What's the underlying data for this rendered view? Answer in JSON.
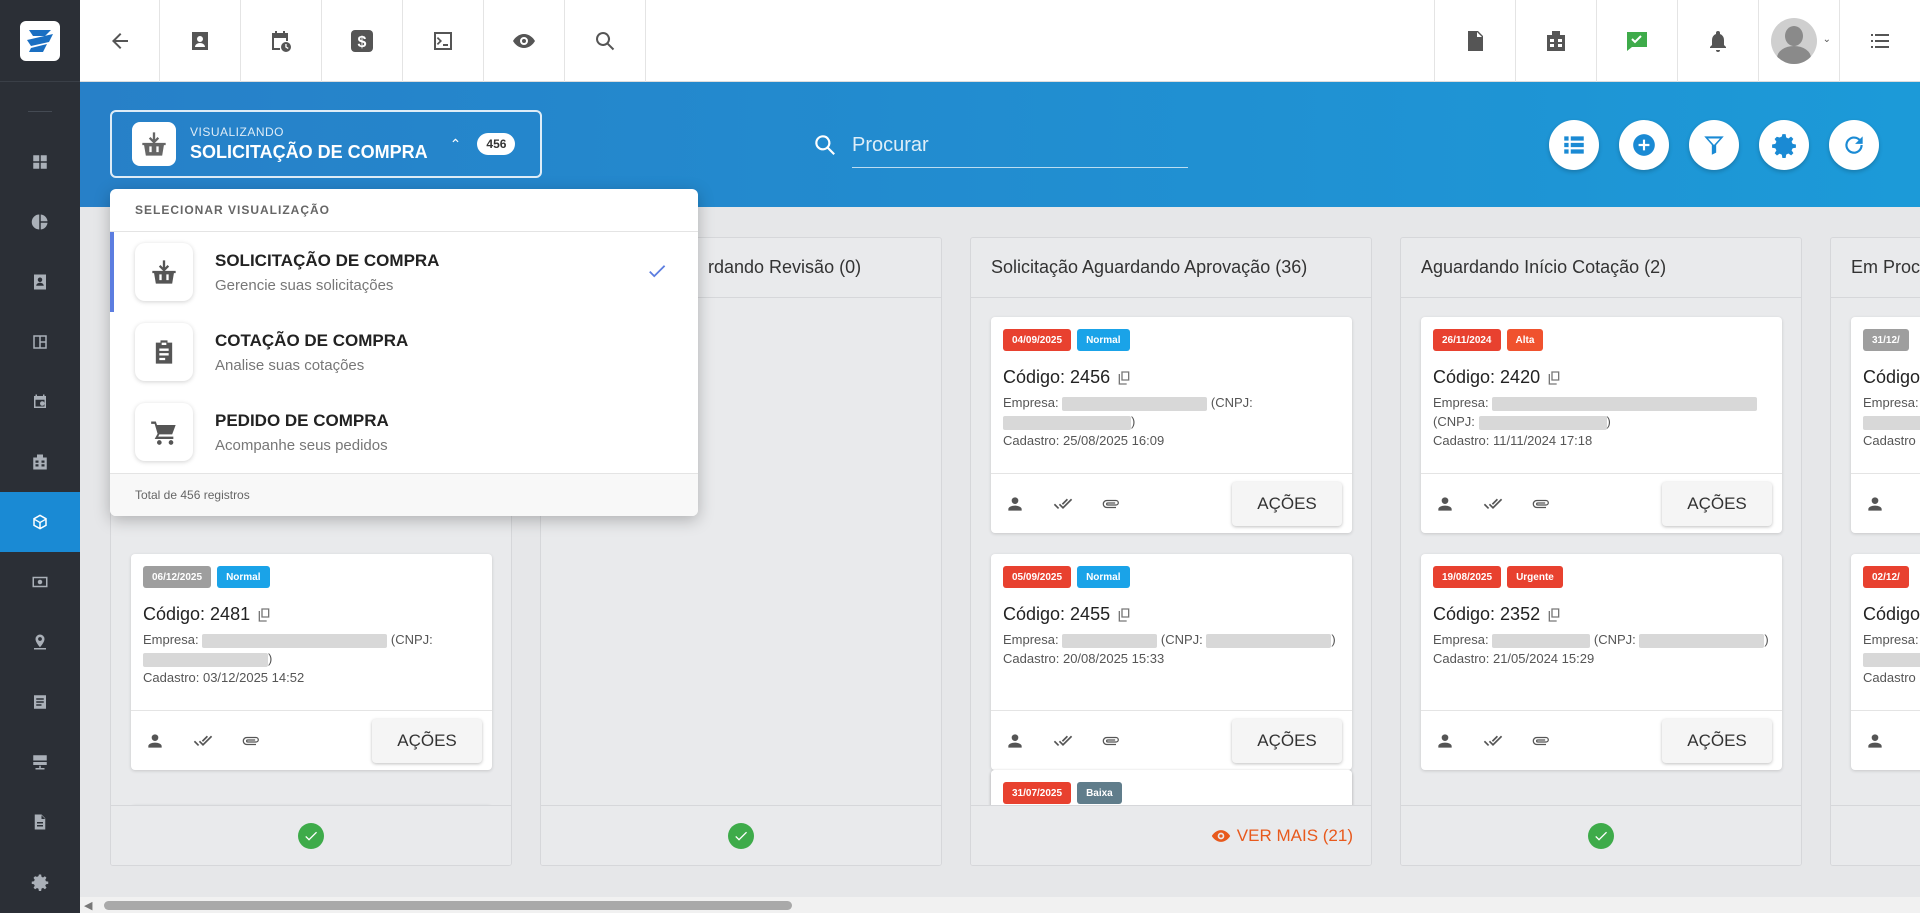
{
  "header": {
    "back_icon": "arrow-left-icon",
    "buttons": [
      "contact-card-icon",
      "calendar-clock-icon",
      "dollar-icon",
      "terminal-icon",
      "eye-icon",
      "search-icon"
    ],
    "right_buttons": [
      "pdf-icon",
      "building-icon",
      "chat-check-icon",
      "bell-icon",
      "avatar",
      "menu-list-icon"
    ]
  },
  "sidebar": {
    "items": [
      "dashboard-icon",
      "pie-chart-icon",
      "contact-icon",
      "board-icon",
      "calendar-icon",
      "building-icon",
      "package-icon",
      "money-icon",
      "map-pin-icon",
      "list-doc-icon",
      "server-icon",
      "file-icon",
      "gear-icon"
    ],
    "active": "package-icon"
  },
  "view_selector": {
    "caption": "VISUALIZANDO",
    "title": "SOLICITAÇÃO DE COMPRA",
    "count": "456"
  },
  "search": {
    "placeholder": "Procurar"
  },
  "dropdown": {
    "header": "SELECIONAR VISUALIZAÇÃO",
    "options": [
      {
        "title": "SOLICITAÇÃO DE COMPRA",
        "subtitle": "Gerencie suas solicitações",
        "selected": true
      },
      {
        "title": "COTAÇÃO DE COMPRA",
        "subtitle": "Analise suas cotações",
        "selected": false
      },
      {
        "title": "PEDIDO DE COMPRA",
        "subtitle": "Acompanhe seus pedidos",
        "selected": false
      }
    ],
    "footer": "Total de 456 registros"
  },
  "columns": [
    {
      "title": "",
      "footer": "check"
    },
    {
      "title": "rdando Revisão (0)",
      "footer": "check"
    },
    {
      "title": "Solicitação Aguardando Aprovação (36)",
      "footer": "VER MAIS (21)"
    },
    {
      "title": "Aguardando Início Cotação (2)",
      "footer": "check"
    },
    {
      "title": "Em Proc",
      "footer": ""
    }
  ],
  "cards": {
    "c1": {
      "date": "06/12/2025",
      "priority": "Normal",
      "code": "Código: 2481",
      "empresa": "Empresa:",
      "cnpj": "(CNPJ:",
      "cadastro": "Cadastro: 03/12/2025 14:52",
      "action": "AÇÕES"
    },
    "c2": {
      "date": "04/09/2025",
      "priority": "Normal",
      "code": "Código: 2456",
      "empresa": "Empresa:",
      "cnpj": "(CNPJ:",
      "cadastro": "Cadastro: 25/08/2025 16:09",
      "action": "AÇÕES"
    },
    "c3": {
      "date": "05/09/2025",
      "priority": "Normal",
      "code": "Código: 2455",
      "empresa": "Empresa:",
      "cnpj": "(CNPJ:",
      "cadastro": "Cadastro: 20/08/2025 15:33",
      "action": "AÇÕES"
    },
    "c4": {
      "date": "31/07/2025",
      "priority": "Baixa"
    },
    "c5": {
      "date": "26/11/2024",
      "priority": "Alta",
      "code": "Código: 2420",
      "empresa": "Empresa:",
      "cnpj": "(CNPJ:",
      "cadastro": "Cadastro: 11/11/2024 17:18",
      "action": "AÇÕES"
    },
    "c6": {
      "date": "19/08/2025",
      "priority": "Urgente",
      "code": "Código: 2352",
      "empresa": "Empresa:",
      "cnpj": "(CNPJ:",
      "cadastro": "Cadastro: 21/05/2024 15:29",
      "action": "AÇÕES"
    },
    "c7": {
      "date": "31/12/",
      "code": "Código:",
      "empresa": "Empresa:",
      "cadastro": "Cadastro"
    },
    "c8": {
      "date": "02/12/",
      "code": "Código:",
      "empresa": "Empresa:",
      "cadastro": "Cadastro"
    }
  },
  "colors": {
    "accent": "#1a8ad4",
    "red": "#e8412f",
    "blue": "#1aa3e8",
    "gray": "#9e9e9e",
    "slate": "#607d8b",
    "orange": "#f0522e",
    "green": "#3eab4a"
  }
}
